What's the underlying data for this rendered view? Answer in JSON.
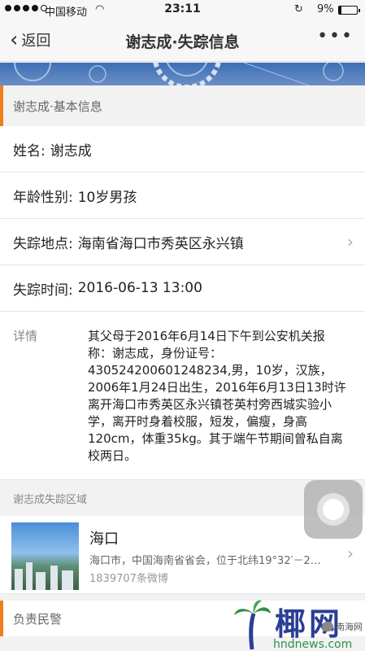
{
  "status_bar": {
    "carrier": "中国移动",
    "time": "23:11",
    "battery_pct": "9%"
  },
  "nav": {
    "back_label": "返回",
    "title": "谢志成·失踪信息",
    "more_label": "•••"
  },
  "basic_section": {
    "header": "谢志成·基本信息",
    "rows": [
      {
        "label": "姓名:",
        "value": "谢志成"
      },
      {
        "label": "年龄性别:",
        "value": "10岁男孩"
      },
      {
        "label": "失踪地点:",
        "value": "海南省海口市秀英区永兴镇"
      },
      {
        "label": "失踪时间:",
        "value": "2016-06-13 13:00"
      }
    ],
    "detail_label": "详情",
    "detail_text": "其父母于2016年6月14日下午到公安机关报称：谢志成，身份证号：430524200601248234,男，10岁，汉族，2006年1月24日出生，2016年6月13日13时许离开海口市秀英区永兴镇苍英村旁西城实验小学，离开时身着校服，短发，偏瘦，身高120cm，体重35kg。其于端午节期间曾私自离校两日。"
  },
  "area_section": {
    "header": "谢志成失踪区域",
    "name": "海口",
    "description": "海口市，中国海南省省会，位于北纬19°32′－2…",
    "count": "1839707条微博"
  },
  "police_section": {
    "header": "负责民警"
  },
  "watermark": {
    "logo": "椰网",
    "site": "hndnews.com",
    "wechat": "南海网"
  },
  "colors": {
    "accent": "#f07f1a",
    "banner": "#3c6fb5"
  }
}
